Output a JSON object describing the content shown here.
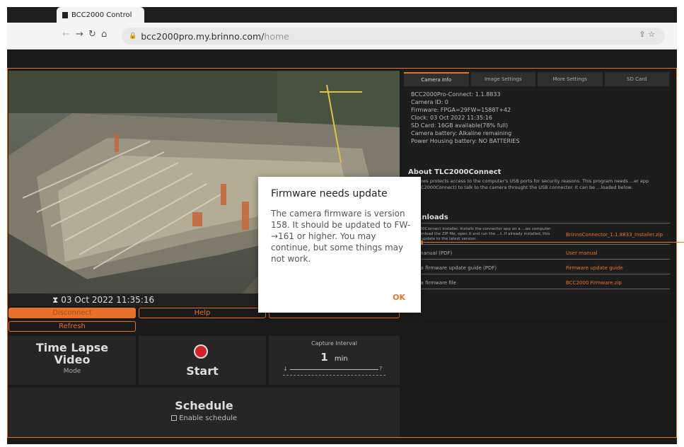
{
  "browser": {
    "tab_title": "BCC2000 Control",
    "url_host": "bcc2000pro.my.brinno.com/",
    "url_path": "home"
  },
  "video": {
    "timestamp": "⧗ 03 Oct 2022 11:35:16"
  },
  "controls": {
    "disconnect": "Disconnect",
    "help": "Help",
    "refresh": "Refresh"
  },
  "mode": {
    "line1": "Time Lapse",
    "line2": "Video",
    "caption": "Mode"
  },
  "start": {
    "label": "Start"
  },
  "capture": {
    "title": "Capture Interval",
    "value": "1",
    "unit": "min",
    "minus": "↓",
    "plus": "?"
  },
  "schedule": {
    "title": "Schedule",
    "checkbox_label": "Enable schedule",
    "checked": false
  },
  "right_panel": {
    "tabs": [
      "Camera Info",
      "Image Settings",
      "More Settings",
      "SD Card"
    ],
    "info_lines": [
      "BCC2000Pro-Connect: 1.1.8833",
      "Camera ID: 0",
      "Firmware: FPGA=29FW=1588T+42",
      "Clock: 03 Oct 2022 11:35:16",
      "SD Card: 16GB available(78% full)",
      "Camera battery: Alkaline remaining",
      "Power Housing battery: NO BATTERIES"
    ],
    "about_title": "About TLC2000Connect",
    "about_text": "...lows protects access to the computer's USB ports for security reasons. This program needs ...er app (TLC2000Connect) to talk to the camera throught the USB connector. It can be ...loaded below.",
    "downloads_title": "...nloads",
    "downloads": [
      {
        "label": "...000Connect Installer. Installs the connector app on a ...ws computer. Download the ZIP file, open it and run the ...t. If already installed, this will update to the latest version.",
        "link": "BrinnoConnector_1.1.8833_Installer.zip"
      },
      {
        "label": "...manual (PDF)",
        "link": "User manual"
      },
      {
        "label": "...ra firmware update guide (PDF)",
        "link": "Firmware update guide"
      },
      {
        "label": "...ra firmware file",
        "link": "BCC2000 Firmware.zip"
      }
    ]
  },
  "dialog": {
    "title": "Firmware needs update",
    "body": "The camera firmware is version 158. It should be updated to FW-→161 or higher. You may continue, but some things may not work.",
    "ok": "OK"
  },
  "colors": {
    "accent": "#e8722a",
    "background": "#1a1a1a",
    "panel": "#262626"
  }
}
